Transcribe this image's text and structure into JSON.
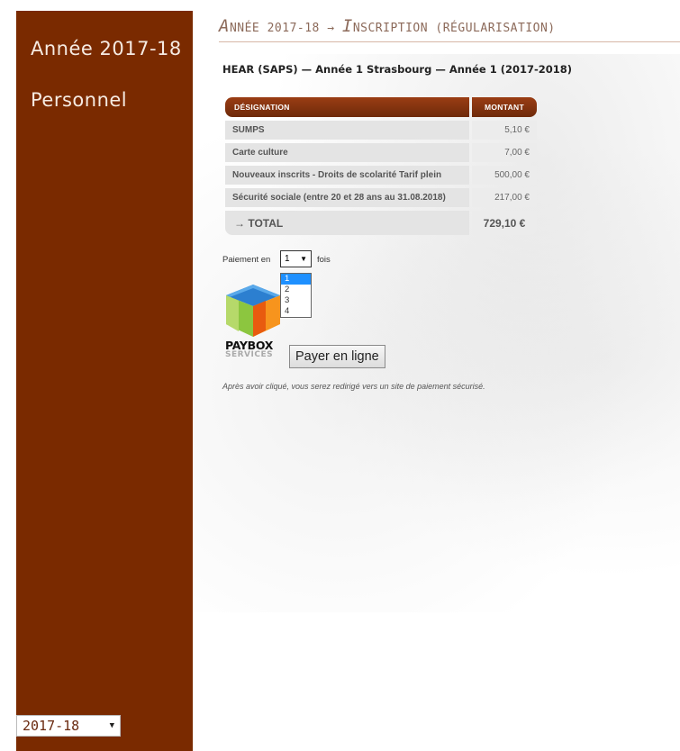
{
  "sidebar": {
    "year_item": "Année 2017-18",
    "staff_item": "Personnel",
    "year_select_value": "2017-18",
    "colors": {
      "background": "#7a2a00",
      "text": "#f6ebe2"
    }
  },
  "header": {
    "title_year_initial": "A",
    "title_year_rest": "NNÉE 2017-18",
    "title_arrow": "→",
    "title_section_initial": "I",
    "title_section_rest": "NSCRIPTION (RÉGULARISATION)"
  },
  "subtitle": "HEAR (SAPS) — Année 1 Strasbourg — Année 1 (2017-2018)",
  "fees_table": {
    "headers": {
      "designation": "Désignation",
      "amount": "Montant"
    },
    "rows": [
      {
        "label": "SUMPS",
        "amount": "5,10 €"
      },
      {
        "label": "Carte culture",
        "amount": "7,00 €"
      },
      {
        "label": "Nouveaux inscrits - Droits de scolarité Tarif plein",
        "amount": "500,00 €"
      },
      {
        "label": "Sécurité sociale (entre 20 et 28 ans au 31.08.2018)",
        "amount": "217,00 €"
      }
    ],
    "total": {
      "label": "→ TOTAL",
      "amount": "729,10 €"
    },
    "header_color": "#7a2a00"
  },
  "payment": {
    "label_before": "Paiement en",
    "label_after": "fois",
    "selected": "1",
    "options": [
      "1",
      "2",
      "3",
      "4"
    ],
    "highlight_color": "#1e90ff",
    "provider_name": "PAYBOX",
    "provider_sub": "SERVICES",
    "pay_button": "Payer en ligne",
    "note": "Après avoir cliqué, vous serez redirigé vers un site de paiement sécurisé."
  }
}
